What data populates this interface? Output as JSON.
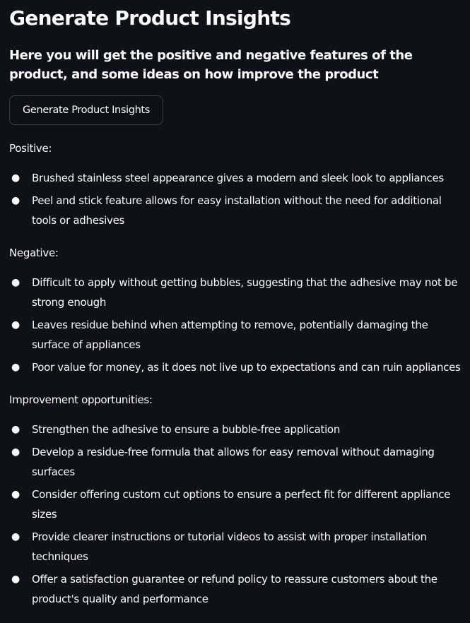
{
  "page": {
    "title": "Generate Product Insights",
    "subtitle": "Here you will get the positive and negative features of the product, and some ideas on how improve the product",
    "button_label": "Generate Product Insights"
  },
  "sections": {
    "positive": {
      "heading": "Positive:",
      "items": [
        "Brushed stainless steel appearance gives a modern and sleek look to appliances",
        "Peel and stick feature allows for easy installation without the need for additional tools or adhesives"
      ]
    },
    "negative": {
      "heading": "Negative:",
      "items": [
        "Difficult to apply without getting bubbles, suggesting that the adhesive may not be strong enough",
        "Leaves residue behind when attempting to remove, potentially damaging the surface of appliances",
        "Poor value for money, as it does not live up to expectations and can ruin appliances"
      ]
    },
    "improvement": {
      "heading": "Improvement opportunities:",
      "items": [
        "Strengthen the adhesive to ensure a bubble-free application",
        "Develop a residue-free formula that allows for easy removal without damaging surfaces",
        "Consider offering custom cut options to ensure a perfect fit for different appliance sizes",
        "Provide clearer instructions or tutorial videos to assist with proper installation techniques",
        "Offer a satisfaction guarantee or refund policy to reassure customers about the product's quality and performance"
      ]
    }
  },
  "theme": {
    "background": "#0e1117",
    "text": "#fafafa",
    "button_border": "#3a3d46"
  }
}
